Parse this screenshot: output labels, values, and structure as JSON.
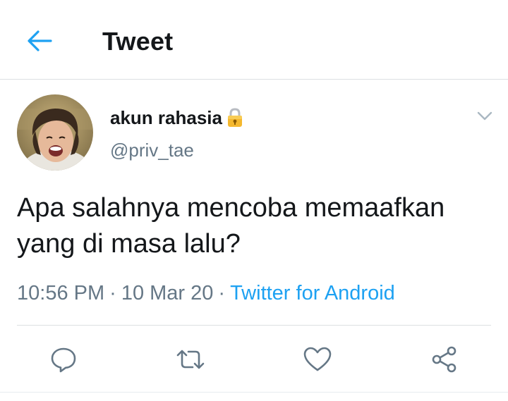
{
  "header": {
    "title": "Tweet",
    "back_icon": "arrow-left-icon"
  },
  "tweet": {
    "author": {
      "display_name": "akun rahasia",
      "badge_icon": "lock-emoji-icon",
      "handle": "@priv_tae"
    },
    "text": "Apa salahnya mencoba memaafkan yang di masa lalu?",
    "time": "10:56 PM",
    "date": "10 Mar 20",
    "separator": "·",
    "source": "Twitter for Android"
  },
  "actions": [
    {
      "name": "reply",
      "icon": "reply-bubble-icon"
    },
    {
      "name": "retweet",
      "icon": "retweet-icon"
    },
    {
      "name": "like",
      "icon": "heart-icon"
    },
    {
      "name": "share",
      "icon": "share-icon"
    }
  ],
  "colors": {
    "accent": "#1da1f2",
    "text": "#14171a",
    "secondary": "#657786",
    "divider": "#dcdfe2",
    "lock_gold": "#f5b82e"
  }
}
